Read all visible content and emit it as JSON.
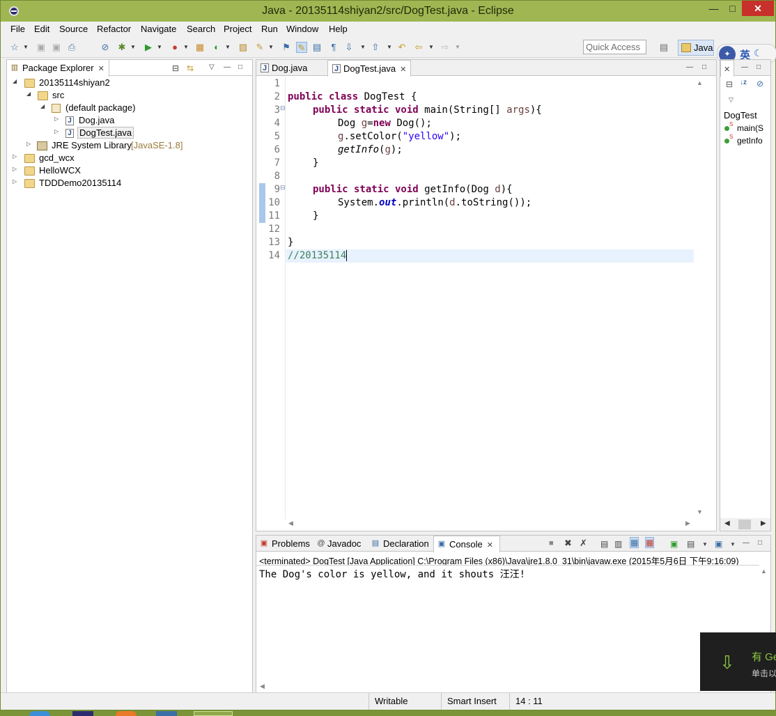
{
  "window": {
    "title": "Java - 20135114shiyan2/src/DogTest.java - Eclipse"
  },
  "menu": [
    "File",
    "Edit",
    "Source",
    "Refactor",
    "Navigate",
    "Search",
    "Project",
    "Run",
    "Window",
    "Help"
  ],
  "toolbar": {
    "quick_access": "Quick Access",
    "perspective": "Java"
  },
  "package_explorer": {
    "tab_label": "Package Explorer",
    "items": [
      {
        "label": "20135114shiyan2"
      },
      {
        "label": "src"
      },
      {
        "label": "(default package)"
      },
      {
        "label": "Dog.java"
      },
      {
        "label": "DogTest.java"
      },
      {
        "label": "JRE System Library",
        "suffix": "[JavaSE-1.8]"
      },
      {
        "label": "gcd_wcx"
      },
      {
        "label": "HelloWCX"
      },
      {
        "label": "TDDDemo20135114"
      }
    ]
  },
  "editor": {
    "tabs": [
      {
        "label": "Dog.java"
      },
      {
        "label": "DogTest.java"
      }
    ],
    "line_numbers": [
      "1",
      "2",
      "3",
      "4",
      "5",
      "6",
      "7",
      "8",
      "9",
      "10",
      "11",
      "12",
      "13",
      "14"
    ],
    "code": {
      "l2_kw": "public class",
      "l2_rest": " DogTest {",
      "l3_kw": "public static void",
      "l3_a": " main(String[] ",
      "l3_var": "args",
      "l3_b": "){",
      "l4_a": "Dog ",
      "l4_var": "g",
      "l4_b": "=",
      "l4_kw": "new",
      "l4_c": " Dog();",
      "l5_var": "g",
      "l5_a": ".setColor(",
      "l5_str": "\"yellow\"",
      "l5_b": ");",
      "l6_it": "getInfo",
      "l6_a": "(",
      "l6_var": "g",
      "l6_b": ");",
      "l7": "}",
      "l9_kw": "public static void",
      "l9_a": " getInfo(Dog ",
      "l9_var": "d",
      "l9_b": "){",
      "l10_a": "System.",
      "l10_fld": "out",
      "l10_b": ".println(",
      "l10_var": "d",
      "l10_c": ".toString());",
      "l11": "}",
      "l13": "}",
      "l14_cmt": "//20135114"
    }
  },
  "outline": {
    "title": "DogTest",
    "items": [
      "main(S",
      "getInfo"
    ]
  },
  "bottom_panel": {
    "tabs": [
      "Problems",
      "Javadoc",
      "Declaration",
      "Console"
    ],
    "terminated_line": "<terminated> DogTest [Java Application] C:\\Program Files (x86)\\Java\\jre1.8.0_31\\bin\\javaw.exe (2015年5月6日 下午9:16:09)",
    "output": "The Dog's color is yellow, and it shouts 汪汪!"
  },
  "status": {
    "writable": "Writable",
    "insert_mode": "Smart Insert",
    "position": "14 : 11"
  },
  "ime": {
    "label": "英"
  },
  "toast": {
    "title": "有 Ge",
    "body": "单击以"
  }
}
